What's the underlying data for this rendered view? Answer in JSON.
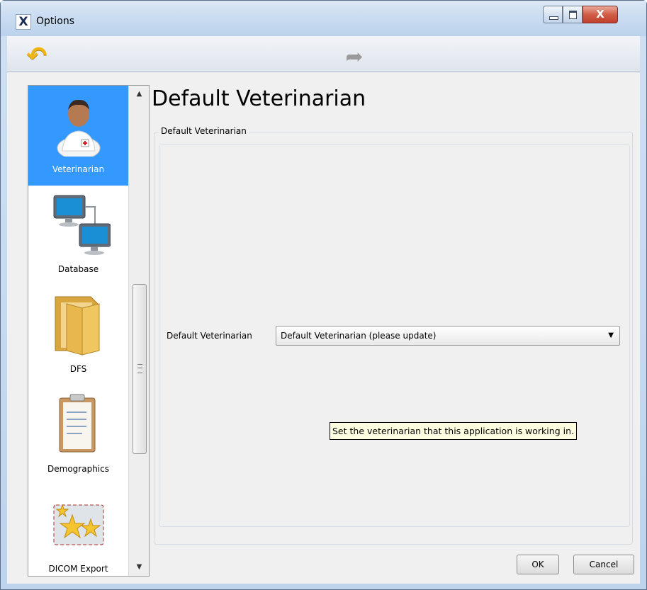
{
  "window": {
    "title": "Options",
    "app_icon": "X",
    "close_glyph": "X"
  },
  "toolbar": {
    "back_icon": "back-arrow-icon",
    "forward_icon": "forward-arrow-icon"
  },
  "sidebar": {
    "items": [
      {
        "label": "Veterinarian",
        "icon": "veterinarian-icon",
        "selected": true
      },
      {
        "label": "Database",
        "icon": "database-icon",
        "selected": false
      },
      {
        "label": "DFS",
        "icon": "folder-icon",
        "selected": false
      },
      {
        "label": "Demographics",
        "icon": "clipboard-icon",
        "selected": false
      },
      {
        "label": "DICOM Export",
        "icon": "dicom-export-icon",
        "selected": false
      }
    ]
  },
  "page": {
    "title": "Default Veterinarian",
    "group_title": "Default Veterinarian",
    "field_label": "Default Veterinarian",
    "field_value": "Default Veterinarian (please update)",
    "tooltip": "Set the veterinarian that this application is working in."
  },
  "buttons": {
    "ok": "OK",
    "cancel": "Cancel"
  },
  "colors": {
    "selection": "#3399ff",
    "tooltip_bg": "#ffffe1",
    "back_arrow": "#f1b612"
  }
}
